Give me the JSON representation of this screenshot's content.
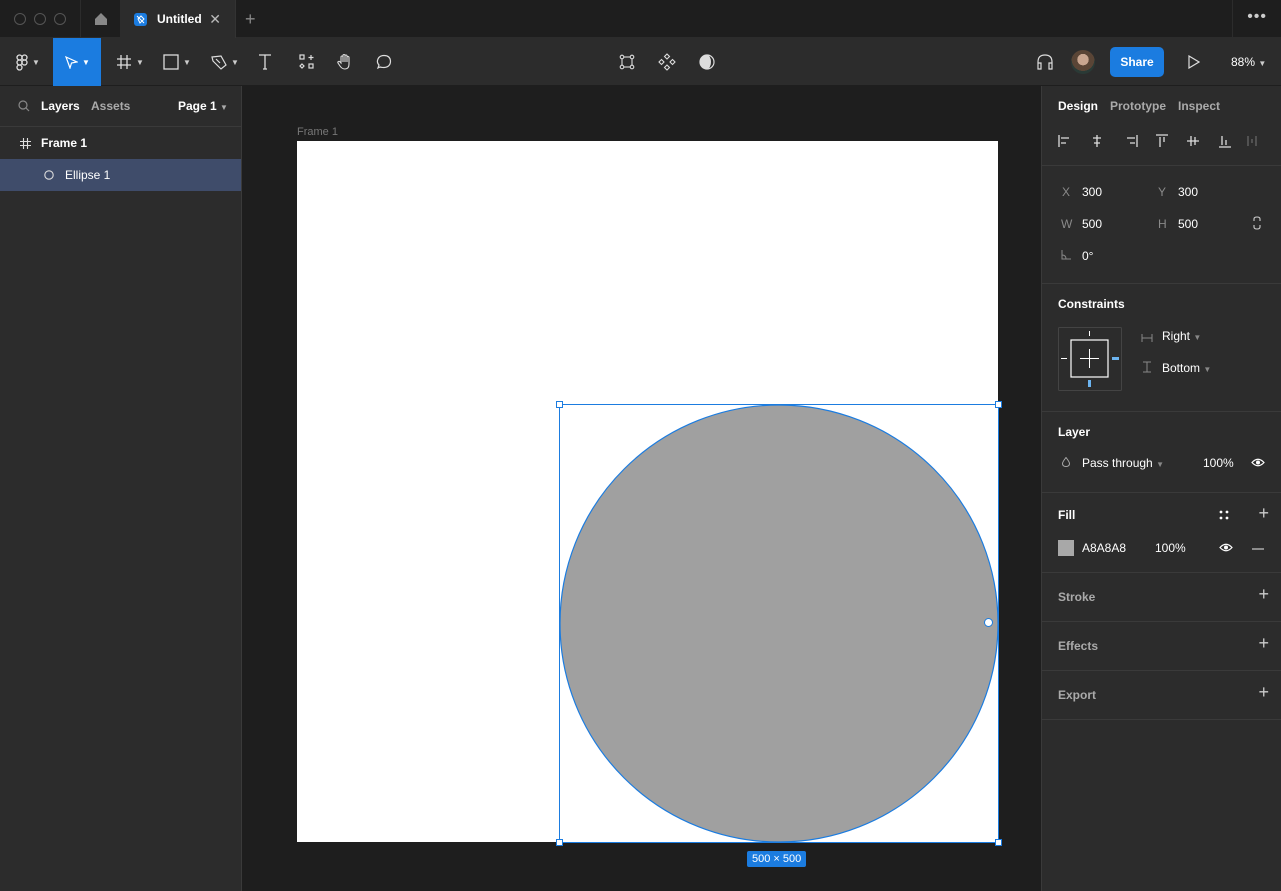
{
  "window": {
    "tab_title": "Untitled",
    "new_tab": "+",
    "more": "•••"
  },
  "toolbar": {
    "share_label": "Share",
    "zoom_level": "88%",
    "tools": [
      "main-menu",
      "move",
      "frame",
      "shape",
      "pen",
      "text",
      "resources",
      "hand",
      "comment"
    ],
    "center_tools": [
      "component-edit",
      "create-component",
      "mask"
    ]
  },
  "left_panel": {
    "tabs": [
      "Layers",
      "Assets"
    ],
    "page_selector": "Page 1",
    "layers": [
      {
        "name": "Frame 1",
        "type": "frame",
        "selected": false
      },
      {
        "name": "Ellipse 1",
        "type": "ellipse",
        "selected": true
      }
    ]
  },
  "canvas": {
    "frame_label": "Frame 1",
    "dimension_badge": "500 × 500",
    "ellipse_fill": "#A8A8A8",
    "selection_color": "#1B7CE0"
  },
  "right_panel": {
    "tabs": [
      "Design",
      "Prototype",
      "Inspect"
    ],
    "position": {
      "x_label": "X",
      "x": "300",
      "y_label": "Y",
      "y": "300"
    },
    "size": {
      "w_label": "W",
      "w": "500",
      "h_label": "H",
      "h": "500"
    },
    "rotation": "0°",
    "constraints": {
      "title": "Constraints",
      "horizontal": "Right",
      "vertical": "Bottom"
    },
    "layer": {
      "title": "Layer",
      "blend": "Pass through",
      "opacity": "100%"
    },
    "fill": {
      "title": "Fill",
      "hex": "A8A8A8",
      "opacity": "100%",
      "swatch": "#A8A8A8"
    },
    "stroke": {
      "title": "Stroke"
    },
    "effects": {
      "title": "Effects"
    },
    "export": {
      "title": "Export"
    }
  }
}
